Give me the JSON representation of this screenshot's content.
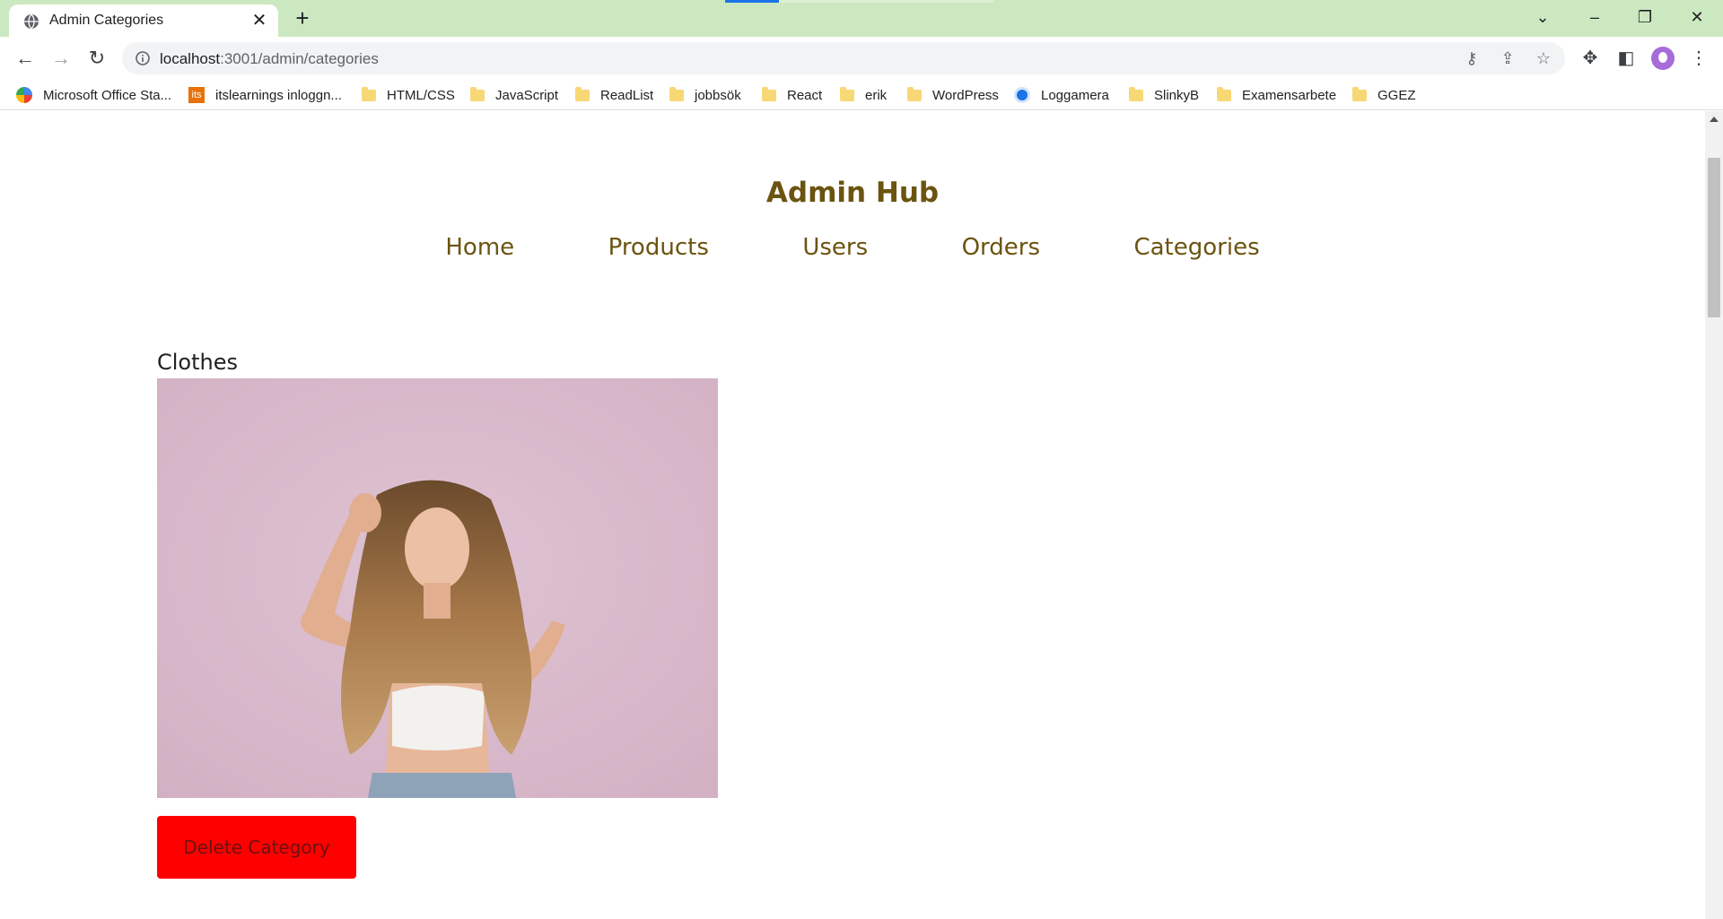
{
  "browser": {
    "tab_title": "Admin Categories",
    "url_host": "localhost",
    "url_rest": ":3001/admin/categories",
    "bookmarks": [
      {
        "label": "Microsoft Office Sta...",
        "icon": "microsoft-icon"
      },
      {
        "label": "itslearnings inloggn...",
        "icon": "its-icon"
      },
      {
        "label": "HTML/CSS",
        "icon": "folder-icon"
      },
      {
        "label": "JavaScript",
        "icon": "folder-icon"
      },
      {
        "label": "ReadList",
        "icon": "folder-icon"
      },
      {
        "label": "jobbsök",
        "icon": "folder-icon"
      },
      {
        "label": "React",
        "icon": "folder-icon"
      },
      {
        "label": "erik",
        "icon": "folder-icon"
      },
      {
        "label": "WordPress",
        "icon": "folder-icon"
      },
      {
        "label": "Loggamera",
        "icon": "loggamera-icon"
      },
      {
        "label": "SlinkyB",
        "icon": "folder-icon"
      },
      {
        "label": "Examensarbete",
        "icon": "folder-icon"
      },
      {
        "label": "GGEZ",
        "icon": "folder-icon"
      }
    ],
    "its_badge": "its",
    "colors": {
      "titlebar": "#cce8c0",
      "accent": "#1a73e8"
    }
  },
  "page": {
    "title": "Admin Hub",
    "nav": [
      "Home",
      "Products",
      "Users",
      "Orders",
      "Categories"
    ],
    "category": {
      "name": "Clothes",
      "delete_label": "Delete Category"
    },
    "colors": {
      "heading": "#6b5410",
      "delete_button": "#ff0000"
    }
  }
}
